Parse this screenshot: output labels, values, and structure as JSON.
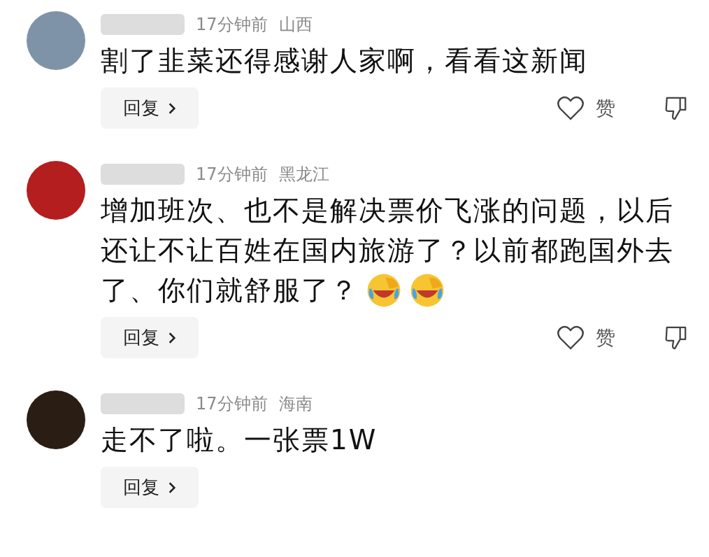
{
  "comments": [
    {
      "color": "#7f93a8",
      "time": "17分钟前",
      "region": "山西",
      "lines": [
        "割了韭菜还得感谢人家啊，看看这新闻"
      ],
      "reply": "回复",
      "like": "赞"
    },
    {
      "color": "#b41e1e",
      "time": "17分钟前",
      "region": "黑龙江",
      "lines": [
        "增加班次、也不是解决票价飞涨的问题，以后",
        "还让不让百姓在国内旅游了？以前都跑国外去",
        "了、你们就舒服了？"
      ],
      "emojis": [
        {
          "kind": "laugh-cry"
        },
        {
          "kind": "laugh-cry"
        }
      ],
      "reply": "回复",
      "like": "赞"
    },
    {
      "color": "#2a1d14",
      "time": "17分钟前",
      "region": "海南",
      "lines": [
        "走不了啦。一张票1W"
      ],
      "reply": "回复"
    }
  ]
}
